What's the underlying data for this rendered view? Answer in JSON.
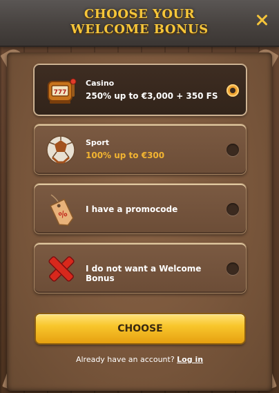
{
  "header": {
    "title_line1": "CHOOSE YOUR",
    "title_line2": "WELCOME BONUS",
    "close_icon": "close-icon"
  },
  "options": [
    {
      "title": "Casino",
      "subtitle": "250% up to €3,000 + 350 FS",
      "icon": "slot-machine-icon",
      "selected": true
    },
    {
      "title": "Sport",
      "subtitle": "100% up to €300",
      "icon": "football-icon",
      "selected": false
    },
    {
      "title": "I have a promocode",
      "icon": "price-tag-icon",
      "selected": false
    },
    {
      "title": "I do not want a Welcome Bonus",
      "icon": "red-cross-icon",
      "selected": false
    }
  ],
  "choose_button": "CHOOSE",
  "footer": {
    "prompt": "Already have an account?",
    "login_link": "Log in"
  },
  "colors": {
    "accent_gold": "#f6c63a",
    "button_yellow": "#f8c62c",
    "sport_text": "#f2b431"
  }
}
